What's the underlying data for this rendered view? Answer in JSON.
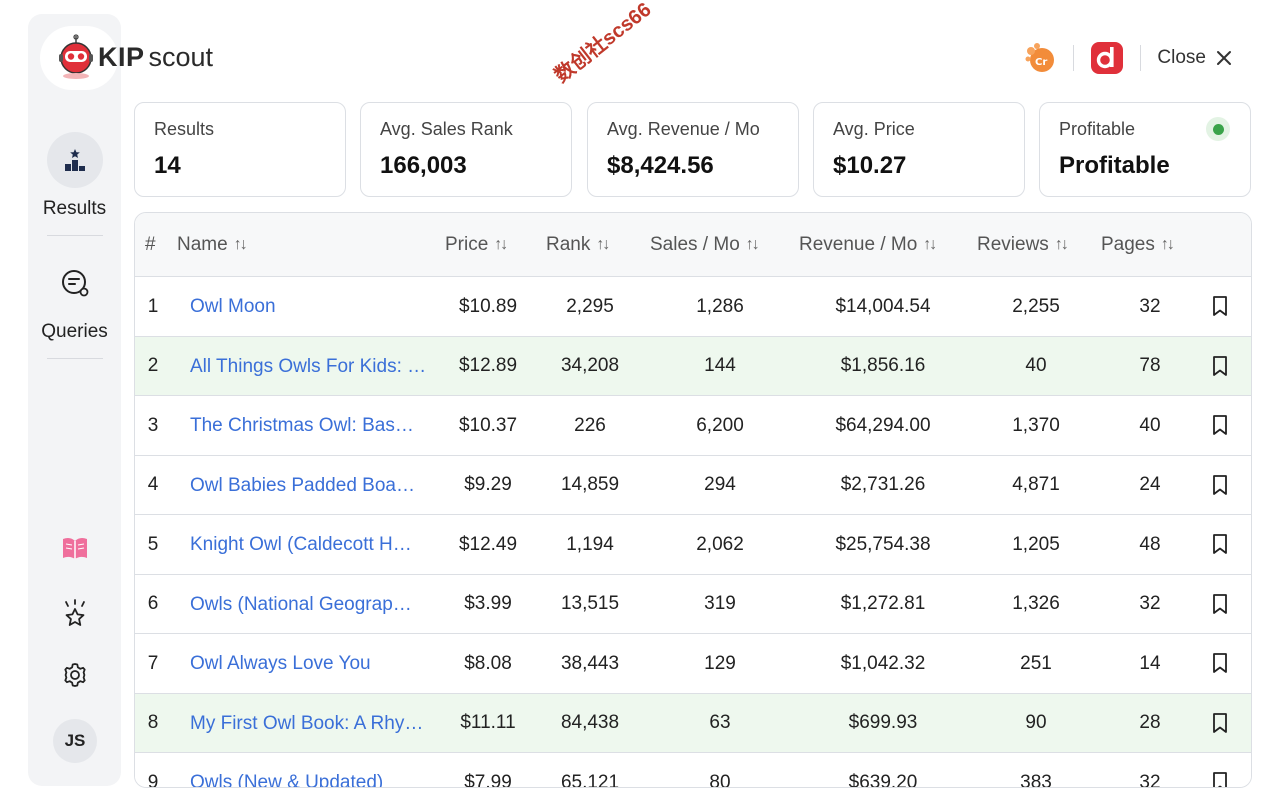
{
  "brand": {
    "part1": "KIP",
    "part2": "scout"
  },
  "watermark": "数创社scs66",
  "header": {
    "close_label": "Close"
  },
  "sidebar": {
    "items": [
      {
        "label": "Results",
        "icon": "results-icon",
        "active": true
      },
      {
        "label": "Queries",
        "icon": "queries-icon",
        "active": false
      }
    ],
    "bottom_icons": [
      "book-icon",
      "star-sparkle-icon",
      "gear-icon"
    ],
    "avatar_initials": "JS"
  },
  "stats": [
    {
      "label": "Results",
      "value": "14"
    },
    {
      "label": "Avg. Sales Rank",
      "value": "166,003"
    },
    {
      "label": "Avg. Revenue / Mo",
      "value": "$8,424.56"
    },
    {
      "label": "Avg. Price",
      "value": "$10.27"
    },
    {
      "label": "Profitable",
      "value": "Profitable",
      "status_color": "#3aa34a"
    }
  ],
  "table": {
    "columns": [
      "#",
      "Name",
      "Price",
      "Rank",
      "Sales / Mo",
      "Revenue / Mo",
      "Reviews",
      "Pages"
    ],
    "rows": [
      {
        "num": "1",
        "name": "Owl Moon",
        "price": "$10.89",
        "rank": "2,295",
        "sales": "1,286",
        "revenue": "$14,004.54",
        "reviews": "2,255",
        "pages": "32",
        "highlight": false
      },
      {
        "num": "2",
        "name": "All Things Owls For Kids: …",
        "price": "$12.89",
        "rank": "34,208",
        "sales": "144",
        "revenue": "$1,856.16",
        "reviews": "40",
        "pages": "78",
        "highlight": true
      },
      {
        "num": "3",
        "name": "The Christmas Owl: Bas…",
        "price": "$10.37",
        "rank": "226",
        "sales": "6,200",
        "revenue": "$64,294.00",
        "reviews": "1,370",
        "pages": "40",
        "highlight": false
      },
      {
        "num": "4",
        "name": "Owl Babies Padded Boa…",
        "price": "$9.29",
        "rank": "14,859",
        "sales": "294",
        "revenue": "$2,731.26",
        "reviews": "4,871",
        "pages": "24",
        "highlight": false
      },
      {
        "num": "5",
        "name": "Knight Owl (Caldecott H…",
        "price": "$12.49",
        "rank": "1,194",
        "sales": "2,062",
        "revenue": "$25,754.38",
        "reviews": "1,205",
        "pages": "48",
        "highlight": false
      },
      {
        "num": "6",
        "name": "Owls (National Geograp…",
        "price": "$3.99",
        "rank": "13,515",
        "sales": "319",
        "revenue": "$1,272.81",
        "reviews": "1,326",
        "pages": "32",
        "highlight": false
      },
      {
        "num": "7",
        "name": "Owl Always Love You",
        "price": "$8.08",
        "rank": "38,443",
        "sales": "129",
        "revenue": "$1,042.32",
        "reviews": "251",
        "pages": "14",
        "highlight": false
      },
      {
        "num": "8",
        "name": "My First Owl Book: A Rhy…",
        "price": "$11.11",
        "rank": "84,438",
        "sales": "63",
        "revenue": "$699.93",
        "reviews": "90",
        "pages": "28",
        "highlight": true
      },
      {
        "num": "9",
        "name": "Owls (New & Updated)",
        "price": "$7.99",
        "rank": "65,121",
        "sales": "80",
        "revenue": "$639.20",
        "reviews": "383",
        "pages": "32",
        "highlight": false
      }
    ]
  },
  "colors": {
    "link": "#3a6fd8",
    "highlight_row": "#eef8ee",
    "accent_red": "#e0303a"
  }
}
